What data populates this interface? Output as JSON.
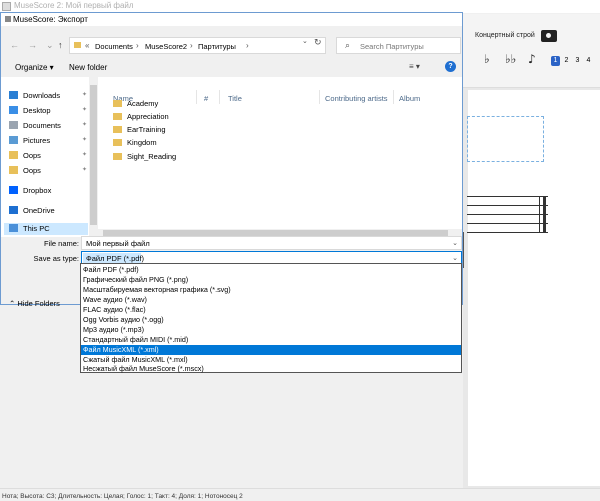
{
  "background": {
    "title": "MuseScore 2: Мой первый файл",
    "concert_pitch": "Концертный строй",
    "accidentals": [
      "♭",
      "♭♭",
      "♪"
    ],
    "voices": [
      "1",
      "2",
      "3",
      "4"
    ],
    "status_bar": "Нота; Высота: C3; Длительность: Целая; Голос: 1;  Такт: 4;  Доля: 1;  Нотоносец 2"
  },
  "dialog": {
    "title": "MuseScore: Экспорт",
    "breadcrumbs": [
      "Documents",
      "MuseScore2",
      "Партитуры"
    ],
    "search_placeholder": "Search Партитуры",
    "organize_label": "Organize ▾",
    "new_folder_label": "New folder",
    "view_icon": "≡ ▾",
    "help_icon": "?",
    "nav_items": [
      {
        "label": "Downloads",
        "icon": "download-icon",
        "pinned": true,
        "color": "#2a7fd4"
      },
      {
        "label": "Desktop",
        "icon": "desktop-icon",
        "pinned": true,
        "color": "#3a8ee6"
      },
      {
        "label": "Documents",
        "icon": "documents-icon",
        "pinned": true,
        "color": "#9aa4b0"
      },
      {
        "label": "Pictures",
        "icon": "pictures-icon",
        "pinned": true,
        "color": "#5a9bd4"
      },
      {
        "label": "Oops",
        "icon": "folder-icon",
        "pinned": true,
        "color": "#e8c05a"
      },
      {
        "label": "Oops",
        "icon": "folder-icon",
        "pinned": true,
        "color": "#e8c05a"
      },
      {
        "label": "Dropbox",
        "icon": "dropbox-icon",
        "pinned": false,
        "color": "#0061fe"
      },
      {
        "label": "OneDrive",
        "icon": "onedrive-icon",
        "pinned": false,
        "color": "#1d6fd1"
      },
      {
        "label": "This PC",
        "icon": "pc-icon",
        "pinned": false,
        "color": "#4a90d9"
      }
    ],
    "columns": [
      "Name",
      "#",
      "Title",
      "Contributing artists",
      "Album"
    ],
    "files": [
      "Academy",
      "Appreciation",
      "EarTraining",
      "Kingdom",
      "Sight_Reading"
    ],
    "file_name_label": "File name:",
    "file_name_value": "Мой первый файл",
    "save_type_label": "Save as type:",
    "save_type_value": "Файл PDF (*.pdf)",
    "hide_folders_label": "Hide Folders",
    "file_types": [
      "Файл PDF (*.pdf)",
      "Графический файл PNG (*.png)",
      "Масштабируемая векторная графика (*.svg)",
      "Wave аудио (*.wav)",
      "FLAC аудио (*.flac)",
      "Ogg Vorbis аудио (*.ogg)",
      "Mp3 аудио (*.mp3)",
      "Стандартный файл MIDI (*.mid)",
      "Файл MusicXML (*.xml)",
      "Сжатый файл MusicXML (*.mxl)",
      "Несжатый файл MuseScore (*.mscx)"
    ],
    "selected_file_type_index": 8
  }
}
